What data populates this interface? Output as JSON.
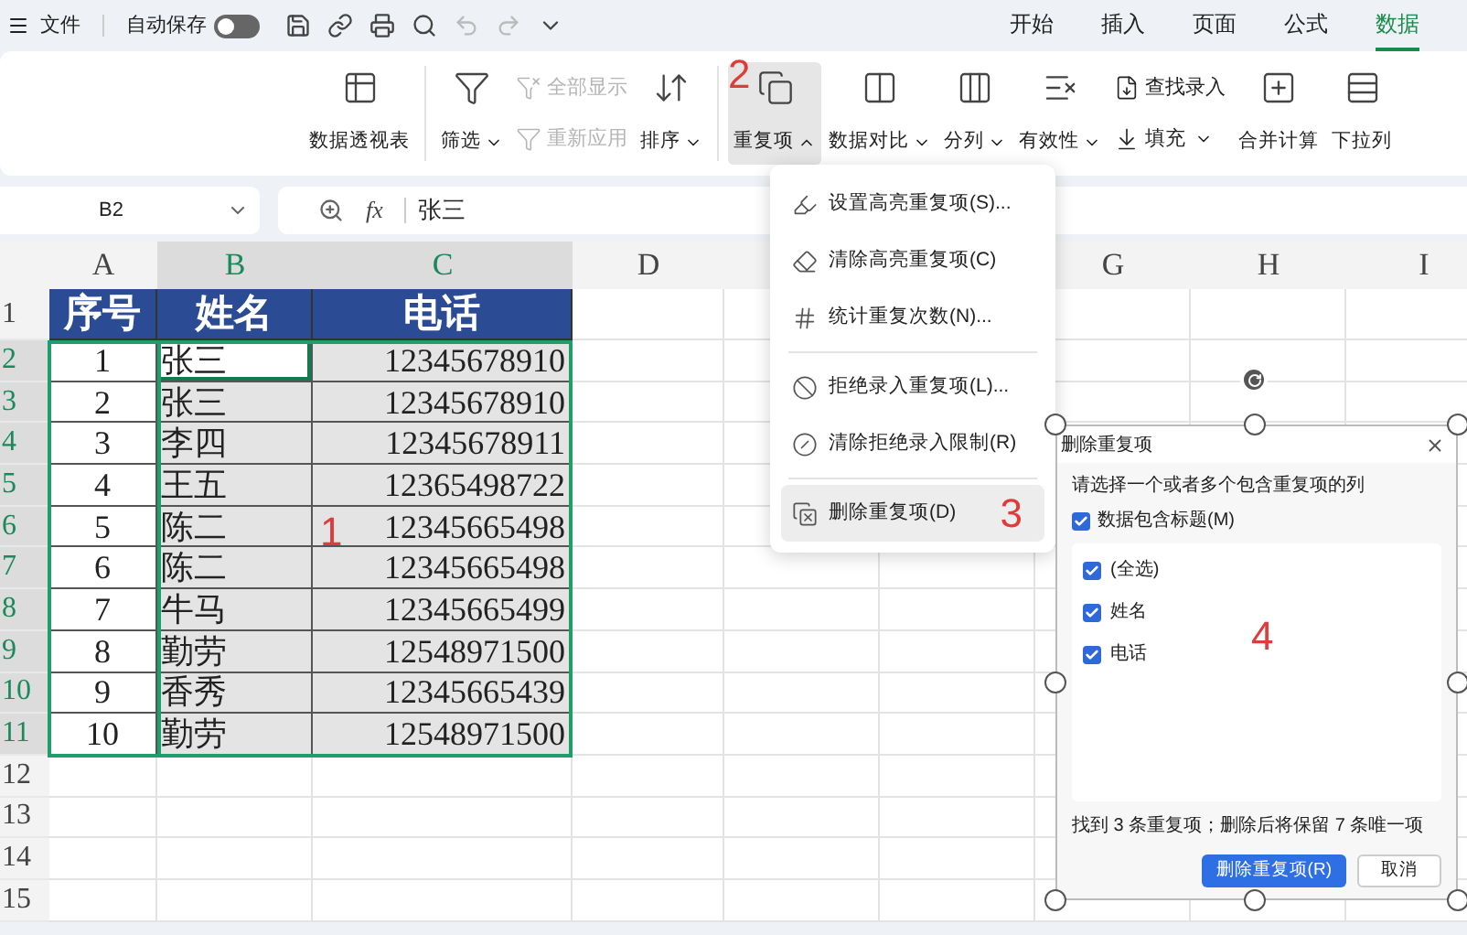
{
  "title_bar": {
    "file_menu": "文件",
    "autosave": {
      "label": "自动保存",
      "on": false
    },
    "quick_access": [
      {
        "disabled": false
      },
      {
        "disabled": false
      },
      {
        "disabled": false
      },
      {
        "disabled": false
      },
      {
        "disabled": true
      },
      {
        "disabled": true
      },
      {
        "disabled": false
      }
    ],
    "tabs": [
      {
        "label": "开始",
        "selected": false
      },
      {
        "label": "插入",
        "selected": false
      },
      {
        "label": "页面",
        "selected": false
      },
      {
        "label": "公式",
        "selected": false
      },
      {
        "label": "数据",
        "selected": true
      }
    ]
  },
  "ribbon": {
    "items": [
      {
        "kind": "large",
        "label": "数据透视表",
        "dropdown": false,
        "expanded": false
      },
      {
        "kind": "separator"
      },
      {
        "kind": "large",
        "label": "筛选",
        "dropdown": true,
        "expanded": false
      },
      {
        "kind": "pair",
        "items": [
          {
            "label": "全部显示",
            "disabled": true,
            "dropdown": false
          },
          {
            "label": "重新应用",
            "disabled": true,
            "dropdown": false
          }
        ]
      },
      {
        "kind": "large",
        "label": "排序",
        "dropdown": true,
        "expanded": false
      },
      {
        "kind": "separator"
      },
      {
        "kind": "large",
        "label": "重复项",
        "dropdown": true,
        "expanded": true,
        "annotation": "2"
      },
      {
        "kind": "large",
        "label": "数据对比",
        "dropdown": true,
        "expanded": false
      },
      {
        "kind": "large",
        "label": "分列",
        "dropdown": true,
        "expanded": false
      },
      {
        "kind": "large",
        "label": "有效性",
        "dropdown": true,
        "expanded": false
      },
      {
        "kind": "pair",
        "items": [
          {
            "label": "查找录入",
            "disabled": false,
            "dropdown": false
          },
          {
            "label": "填充",
            "disabled": false,
            "dropdown": true
          }
        ]
      },
      {
        "kind": "large",
        "label": "合并计算",
        "dropdown": false,
        "expanded": false
      },
      {
        "kind": "large",
        "label": "下拉列",
        "dropdown": false,
        "expanded": false
      }
    ]
  },
  "formula_bar": {
    "cell_ref": "B2",
    "fx": "fx",
    "value": "张三"
  },
  "sheet": {
    "annotation": "1",
    "columns": [
      {
        "kind": "labeled",
        "label": "A",
        "selected": false
      },
      {
        "kind": "labeled",
        "label": "B",
        "selected": true
      },
      {
        "kind": "labeled",
        "label": "C",
        "selected": true
      },
      {
        "kind": "labeled",
        "label": "D",
        "selected": false
      },
      {
        "kind": "blank"
      },
      {
        "kind": "blank"
      },
      {
        "kind": "labeled",
        "label": "G",
        "selected": false
      },
      {
        "kind": "labeled",
        "label": "H",
        "selected": false
      },
      {
        "kind": "labeled",
        "label": "I",
        "selected": false
      }
    ],
    "rows": [
      {
        "label": "1",
        "selected": false,
        "kind": "header",
        "cells": [
          {
            "text": "序号"
          },
          {
            "text": "姓名"
          },
          {
            "text": "电话"
          }
        ]
      },
      {
        "label": "2",
        "selected": true,
        "kind": "data",
        "cells": [
          {
            "text": "1",
            "active": false
          },
          {
            "text": "张三",
            "active": true
          },
          {
            "text": "12345678910",
            "active": false
          }
        ]
      },
      {
        "label": "3",
        "selected": true,
        "kind": "data",
        "cells": [
          {
            "text": "2",
            "active": false
          },
          {
            "text": "张三",
            "active": false
          },
          {
            "text": "12345678910",
            "active": false
          }
        ]
      },
      {
        "label": "4",
        "selected": true,
        "kind": "data",
        "cells": [
          {
            "text": "3",
            "active": false
          },
          {
            "text": "李四",
            "active": false
          },
          {
            "text": "12345678911",
            "active": false
          }
        ]
      },
      {
        "label": "5",
        "selected": true,
        "kind": "data",
        "cells": [
          {
            "text": "4",
            "active": false
          },
          {
            "text": "王五",
            "active": false
          },
          {
            "text": "12365498722",
            "active": false
          }
        ]
      },
      {
        "label": "6",
        "selected": true,
        "kind": "data",
        "cells": [
          {
            "text": "5",
            "active": false
          },
          {
            "text": "陈二",
            "active": false
          },
          {
            "text": "12345665498",
            "active": false
          }
        ]
      },
      {
        "label": "7",
        "selected": true,
        "kind": "data",
        "cells": [
          {
            "text": "6",
            "active": false
          },
          {
            "text": "陈二",
            "active": false
          },
          {
            "text": "12345665498",
            "active": false
          }
        ]
      },
      {
        "label": "8",
        "selected": true,
        "kind": "data",
        "cells": [
          {
            "text": "7",
            "active": false
          },
          {
            "text": "牛马",
            "active": false
          },
          {
            "text": "12345665499",
            "active": false
          }
        ]
      },
      {
        "label": "9",
        "selected": true,
        "kind": "data",
        "cells": [
          {
            "text": "8",
            "active": false
          },
          {
            "text": "勤劳",
            "active": false
          },
          {
            "text": "12548971500",
            "active": false
          }
        ]
      },
      {
        "label": "10",
        "selected": true,
        "kind": "data",
        "cells": [
          {
            "text": "9",
            "active": false
          },
          {
            "text": "香秀",
            "active": false
          },
          {
            "text": "12345665439",
            "active": false
          }
        ]
      },
      {
        "label": "11",
        "selected": true,
        "kind": "data",
        "cells": [
          {
            "text": "10",
            "active": false
          },
          {
            "text": "勤劳",
            "active": false
          },
          {
            "text": "12548971500",
            "active": false
          }
        ]
      },
      {
        "label": "12",
        "selected": false,
        "kind": "empty"
      },
      {
        "label": "13",
        "selected": false,
        "kind": "empty"
      },
      {
        "label": "14",
        "selected": false,
        "kind": "empty"
      },
      {
        "label": "15",
        "selected": false,
        "kind": "empty"
      }
    ]
  },
  "menu": {
    "annotation": "3",
    "items": [
      {
        "kind": "item",
        "label": "设置高亮重复项(S)...",
        "selected": false
      },
      {
        "kind": "item",
        "label": "清除高亮重复项(C)",
        "selected": false
      },
      {
        "kind": "item",
        "label": "统计重复次数(N)...",
        "selected": false
      },
      {
        "kind": "separator"
      },
      {
        "kind": "item",
        "label": "拒绝录入重复项(L)...",
        "selected": false
      },
      {
        "kind": "item",
        "label": "清除拒绝录入限制(R)",
        "selected": false
      },
      {
        "kind": "separator"
      },
      {
        "kind": "item",
        "label": "删除重复项(D)",
        "selected": true
      }
    ]
  },
  "dialog": {
    "title": "删除重复项",
    "prompt": "请选择一个或者多个包含重复项的列",
    "header_option": {
      "label": "数据包含标题(M)",
      "checked": true
    },
    "columns": [
      {
        "label": "(全选)",
        "checked": true
      },
      {
        "label": "姓名",
        "checked": true
      },
      {
        "label": "电话",
        "checked": true
      }
    ],
    "annotation": "4",
    "status": "找到 3 条重复项；删除后将保留 7 条唯一项",
    "buttons": [
      {
        "label": "删除重复项(R)",
        "primary": true
      },
      {
        "label": "取消",
        "primary": false
      }
    ]
  }
}
